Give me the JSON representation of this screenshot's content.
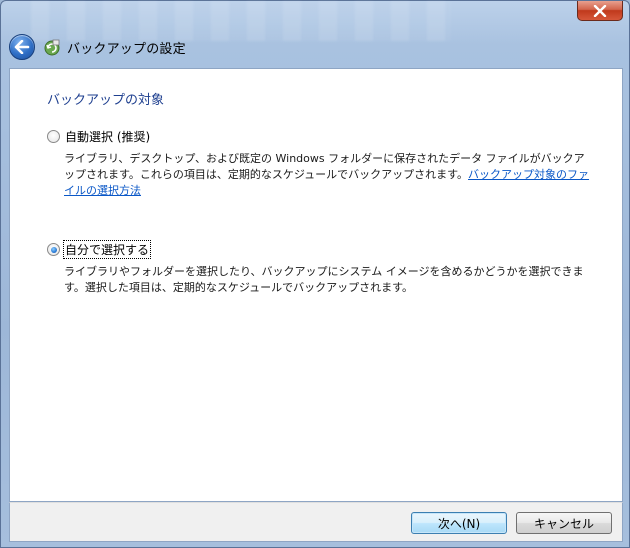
{
  "window": {
    "title": "バックアップの設定",
    "back_icon": "back-arrow-icon",
    "app_icon": "backup-icon",
    "close_icon": "close-icon"
  },
  "content": {
    "section_title": "バックアップの対象",
    "options": [
      {
        "label": "自動選択 (推奨)",
        "checked": false,
        "description": "ライブラリ、デスクトップ、および既定の Windows フォルダーに保存されたデータ ファイルがバックアップされます。これらの項目は、定期的なスケジュールでバックアップされます。",
        "link": "バックアップ対象のファイルの選択方法"
      },
      {
        "label": "自分で選択する",
        "checked": true,
        "description": "ライブラリやフォルダーを選択したり、バックアップにシステム イメージを含めるかどうかを選択できます。選択した項目は、定期的なスケジュールでバックアップされます。"
      }
    ]
  },
  "buttons": {
    "next": "次へ(N)",
    "cancel": "キャンセル"
  },
  "colors": {
    "section_title": "#1e3f8f",
    "link": "#0a57c7",
    "close_button": "#c0391c"
  }
}
